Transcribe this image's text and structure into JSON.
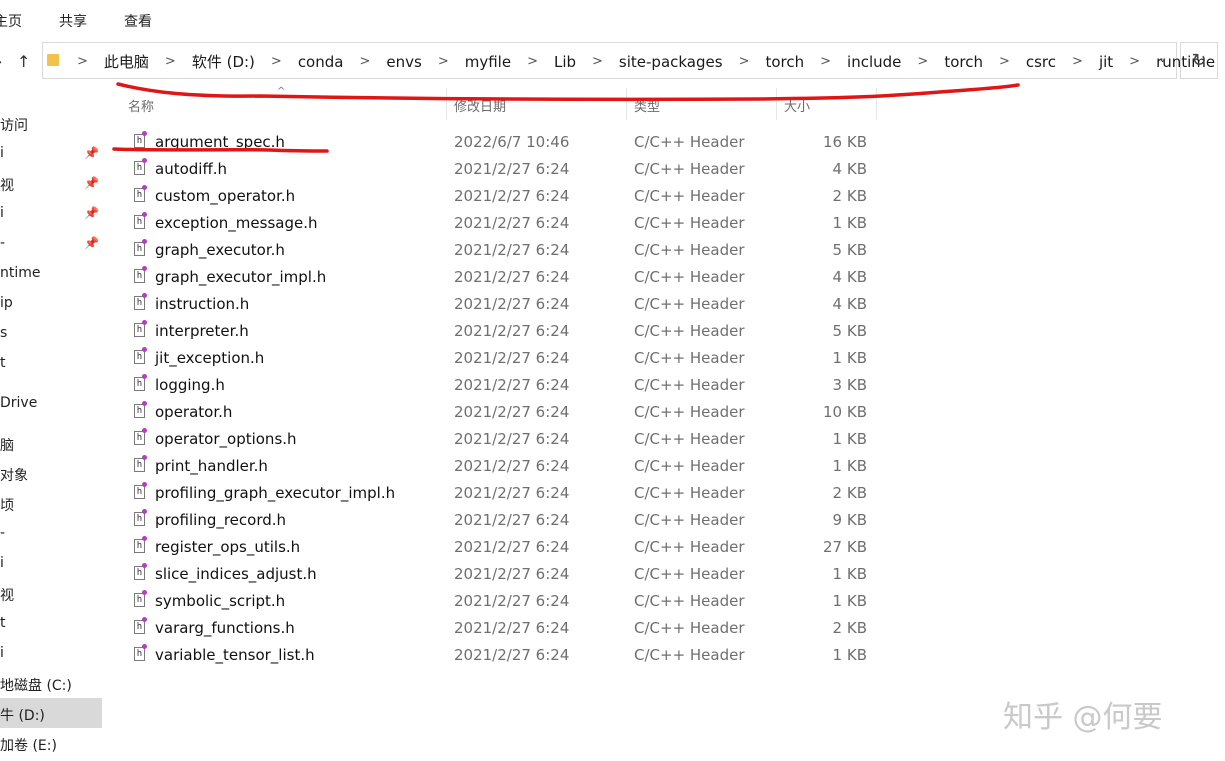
{
  "ribbon": {
    "tabs": [
      "主页",
      "共享",
      "查看"
    ]
  },
  "address": {
    "crumbs": [
      "此电脑",
      "软件 (D:)",
      "conda",
      "envs",
      "myfile",
      "Lib",
      "site-packages",
      "torch",
      "include",
      "torch",
      "csrc",
      "jit",
      "runtime"
    ]
  },
  "nav": {
    "items": [
      "访问",
      "i",
      "视",
      "i",
      "-",
      "ntime",
      "ip",
      "s",
      "t",
      "Drive",
      "脑",
      "对象",
      "顷",
      "-",
      "i",
      "视",
      "t",
      "i",
      "地磁盘 (C:)",
      "牛 (D:)",
      "加卷 (E:)"
    ]
  },
  "columns": {
    "name": "名称",
    "date": "修改日期",
    "type": "类型",
    "size": "大小"
  },
  "files": [
    {
      "name": "argument_spec.h",
      "date": "2022/6/7 10:46",
      "type": "C/C++ Header",
      "size": "16 KB"
    },
    {
      "name": "autodiff.h",
      "date": "2021/2/27 6:24",
      "type": "C/C++ Header",
      "size": "4 KB"
    },
    {
      "name": "custom_operator.h",
      "date": "2021/2/27 6:24",
      "type": "C/C++ Header",
      "size": "2 KB"
    },
    {
      "name": "exception_message.h",
      "date": "2021/2/27 6:24",
      "type": "C/C++ Header",
      "size": "1 KB"
    },
    {
      "name": "graph_executor.h",
      "date": "2021/2/27 6:24",
      "type": "C/C++ Header",
      "size": "5 KB"
    },
    {
      "name": "graph_executor_impl.h",
      "date": "2021/2/27 6:24",
      "type": "C/C++ Header",
      "size": "4 KB"
    },
    {
      "name": "instruction.h",
      "date": "2021/2/27 6:24",
      "type": "C/C++ Header",
      "size": "4 KB"
    },
    {
      "name": "interpreter.h",
      "date": "2021/2/27 6:24",
      "type": "C/C++ Header",
      "size": "5 KB"
    },
    {
      "name": "jit_exception.h",
      "date": "2021/2/27 6:24",
      "type": "C/C++ Header",
      "size": "1 KB"
    },
    {
      "name": "logging.h",
      "date": "2021/2/27 6:24",
      "type": "C/C++ Header",
      "size": "3 KB"
    },
    {
      "name": "operator.h",
      "date": "2021/2/27 6:24",
      "type": "C/C++ Header",
      "size": "10 KB"
    },
    {
      "name": "operator_options.h",
      "date": "2021/2/27 6:24",
      "type": "C/C++ Header",
      "size": "1 KB"
    },
    {
      "name": "print_handler.h",
      "date": "2021/2/27 6:24",
      "type": "C/C++ Header",
      "size": "1 KB"
    },
    {
      "name": "profiling_graph_executor_impl.h",
      "date": "2021/2/27 6:24",
      "type": "C/C++ Header",
      "size": "2 KB"
    },
    {
      "name": "profiling_record.h",
      "date": "2021/2/27 6:24",
      "type": "C/C++ Header",
      "size": "9 KB"
    },
    {
      "name": "register_ops_utils.h",
      "date": "2021/2/27 6:24",
      "type": "C/C++ Header",
      "size": "27 KB"
    },
    {
      "name": "slice_indices_adjust.h",
      "date": "2021/2/27 6:24",
      "type": "C/C++ Header",
      "size": "1 KB"
    },
    {
      "name": "symbolic_script.h",
      "date": "2021/2/27 6:24",
      "type": "C/C++ Header",
      "size": "1 KB"
    },
    {
      "name": "vararg_functions.h",
      "date": "2021/2/27 6:24",
      "type": "C/C++ Header",
      "size": "2 KB"
    },
    {
      "name": "variable_tensor_list.h",
      "date": "2021/2/27 6:24",
      "type": "C/C++ Header",
      "size": "1 KB"
    }
  ],
  "file_icon_glyph": "h",
  "watermark": "知乎 @何要",
  "colors": {
    "annotation_red": "#e01515",
    "selected_drive": "#d9d9d9"
  }
}
